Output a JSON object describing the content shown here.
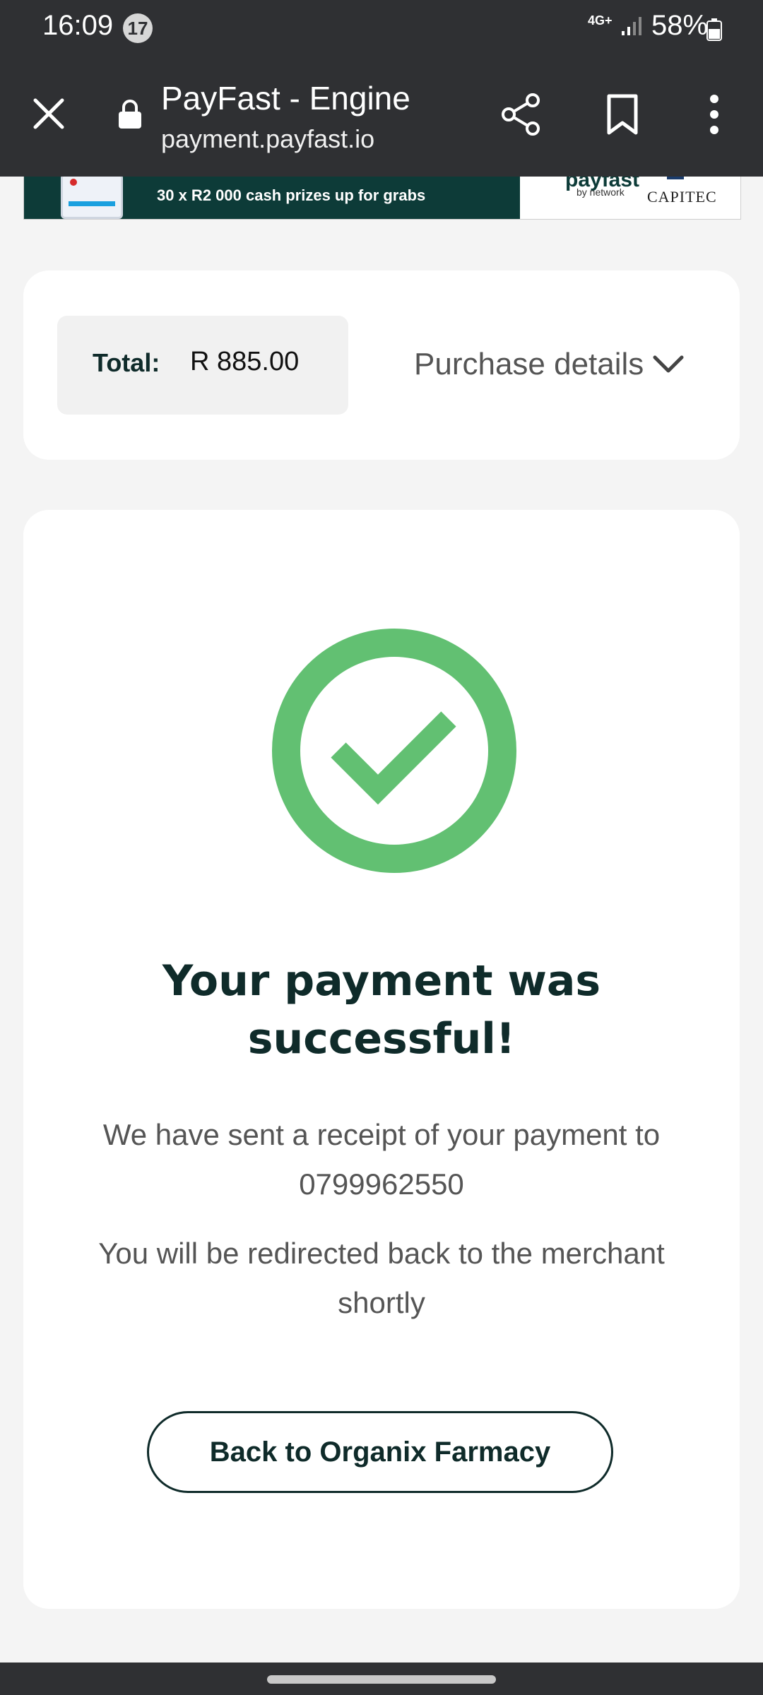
{
  "status_bar": {
    "time": "16:09",
    "notification_count": "17",
    "network": "4G+",
    "battery": "58%"
  },
  "browser": {
    "title": "PayFast - Engine",
    "url": "payment.payfast.io",
    "icons": [
      "close-icon",
      "lock-icon",
      "share-icon",
      "bookmark-icon",
      "more-vert-icon"
    ]
  },
  "banner": {
    "text": "30 x R2 000 cash prizes up for grabs",
    "payfast_logo": "payfast",
    "network_text": "by network",
    "capitec_logo": "CAPITEC"
  },
  "summary": {
    "total_label": "Total:",
    "total_value": "R 885.00",
    "purchase_details_label": "Purchase details"
  },
  "result": {
    "title": "Your payment was successful!",
    "receipt_message": "We have sent a receipt of your payment to 0799962550",
    "redirect_message": "You will be redirected back to the merchant shortly",
    "back_button_label": "Back to Organix Farmacy",
    "success_color": "#62c072"
  },
  "colors": {
    "toolbar": "#2f3033",
    "brand_dark": "#0f2b2a",
    "page_bg": "#f4f4f4"
  }
}
